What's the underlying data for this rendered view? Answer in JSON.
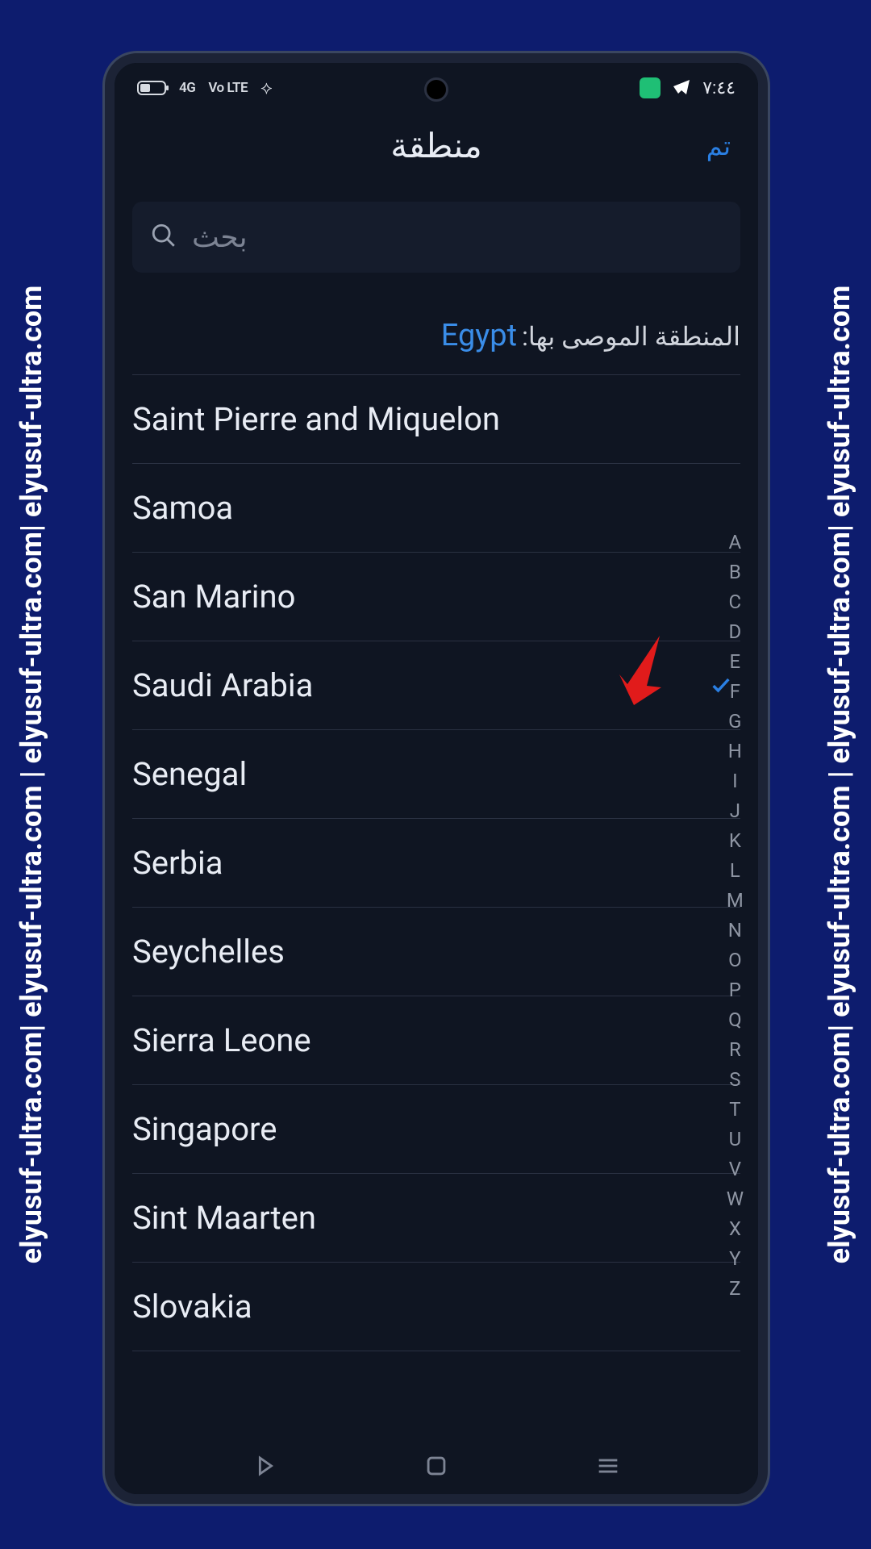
{
  "watermark_text": "elyusuf-ultra.com| elyusuf-ultra.com | elyusuf-ultra.com| elyusuf-ultra.com",
  "status": {
    "signal_4g": "4G",
    "volte": "Vo LTE",
    "time": "٧:٤٤"
  },
  "header": {
    "title": "منطقة",
    "done": "تم"
  },
  "search": {
    "placeholder": "بحث"
  },
  "recommend": {
    "label": "المنطقة الموصى بها:",
    "value": "Egypt"
  },
  "countries": [
    {
      "name": "Saint Pierre and Miquelon",
      "selected": false
    },
    {
      "name": "Samoa",
      "selected": false
    },
    {
      "name": "San Marino",
      "selected": false
    },
    {
      "name": "Saudi Arabia",
      "selected": true
    },
    {
      "name": "Senegal",
      "selected": false
    },
    {
      "name": "Serbia",
      "selected": false
    },
    {
      "name": "Seychelles",
      "selected": false
    },
    {
      "name": "Sierra Leone",
      "selected": false
    },
    {
      "name": "Singapore",
      "selected": false
    },
    {
      "name": "Sint Maarten",
      "selected": false
    },
    {
      "name": "Slovakia",
      "selected": false
    }
  ],
  "alpha_index": [
    "A",
    "B",
    "C",
    "D",
    "E",
    "F",
    "G",
    "H",
    "I",
    "J",
    "K",
    "L",
    "M",
    "N",
    "O",
    "P",
    "Q",
    "R",
    "S",
    "T",
    "U",
    "V",
    "W",
    "X",
    "Y",
    "Z"
  ]
}
